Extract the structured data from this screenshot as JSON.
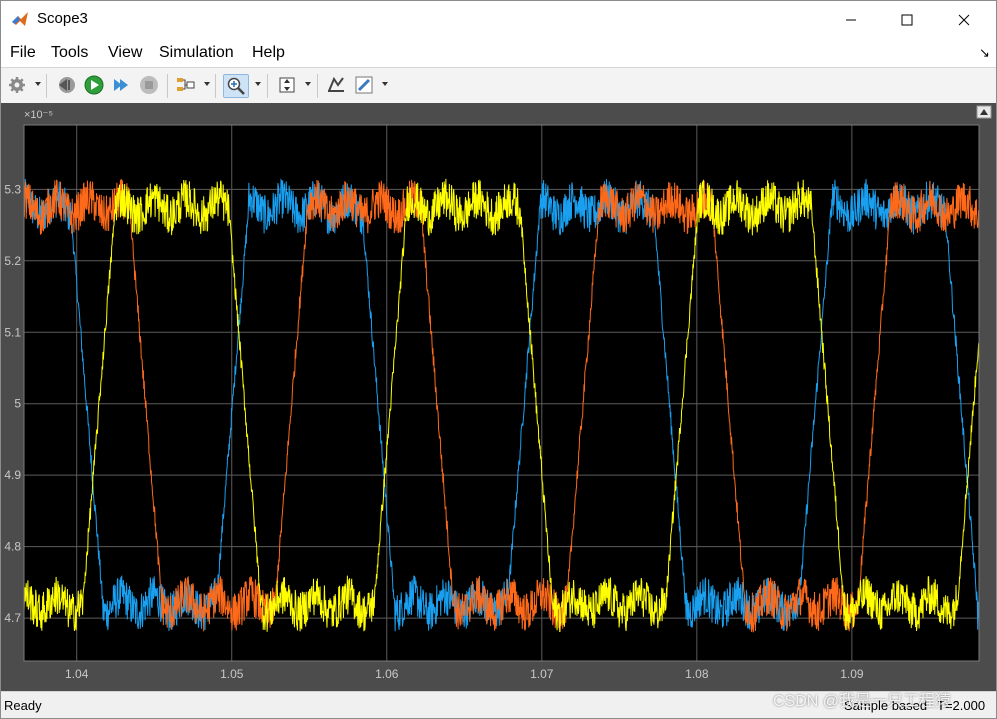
{
  "window": {
    "title": "Scope3"
  },
  "menu": {
    "file": "File",
    "tools": "Tools",
    "view": "View",
    "simulation": "Simulation",
    "help": "Help"
  },
  "toolbar": {
    "icons": [
      "settings-icon",
      "step-back-icon",
      "run-icon",
      "step-forward-icon",
      "stop-icon",
      "signal-select-icon",
      "zoom-icon",
      "autoscale-icon",
      "highlight-icon",
      "edit-icon"
    ]
  },
  "status": {
    "text": "Ready",
    "mode": "Sample based",
    "time": "T=2.000"
  },
  "watermark": "CSDN @我是一只工程猿",
  "colors": {
    "plot_bg": "#000000",
    "figure_bg": "#4c4c4c",
    "grid": "#5c5c5c",
    "axis_text": "#c8c8c8",
    "blue": "#1aa0f0",
    "orange": "#ff6a1a",
    "yellow": "#ffff00"
  },
  "chart_data": {
    "type": "line",
    "exponent_label": "×10⁻⁵",
    "x_ticks": [
      "1.04",
      "1.05",
      "1.06",
      "1.07",
      "1.08",
      "1.09"
    ],
    "x_tick_values": [
      1.04,
      1.05,
      1.06,
      1.07,
      1.08,
      1.09
    ],
    "y_ticks": [
      "4.7",
      "4.8",
      "4.9",
      "5",
      "5.1",
      "5.2",
      "5.3"
    ],
    "y_tick_values": [
      4.7,
      4.8,
      4.9,
      5.0,
      5.1,
      5.2,
      5.3
    ],
    "xlim": [
      1.0366,
      1.0982
    ],
    "ylim": [
      4.64,
      5.39
    ],
    "grid": true,
    "period": 0.0188,
    "levels": {
      "low": 4.72,
      "high": 5.275,
      "noise": 0.028
    },
    "series": [
      {
        "color": "#1aa0f0",
        "phase": 0.2025
      },
      {
        "color": "#ff6a1a",
        "phase": 0.0
      },
      {
        "color": "#ffff00",
        "phase": 0.66
      }
    ]
  }
}
